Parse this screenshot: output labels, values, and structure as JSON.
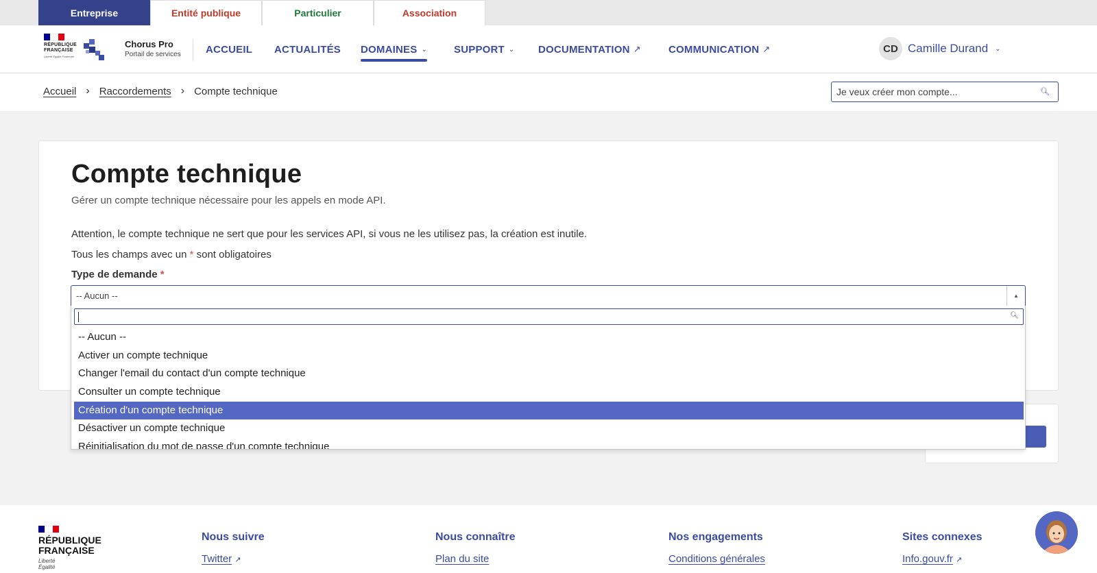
{
  "audience_tabs": [
    {
      "label": "Entreprise",
      "color": "#ffffff"
    },
    {
      "label": "Entité publique",
      "color": "#c0392b"
    },
    {
      "label": "Particulier",
      "color": "#1e7a3a"
    },
    {
      "label": "Association",
      "color": "#c0392b"
    }
  ],
  "brand": {
    "rf_line1": "RÉPUBLIQUE",
    "rf_line2": "FRANÇAISE",
    "motto": "Liberté Égalité Fraternité",
    "name": "Chorus Pro",
    "subtitle": "Portail de services"
  },
  "nav": {
    "items": [
      "ACCUEIL",
      "ACTUALITÉS",
      "DOMAINES",
      "SUPPORT",
      "DOCUMENTATION",
      "COMMUNICATION"
    ],
    "active": "DOMAINES"
  },
  "user": {
    "initials": "CD",
    "name": "Camille Durand"
  },
  "breadcrumb": {
    "items": [
      "Accueil",
      "Raccordements",
      "Compte technique"
    ]
  },
  "search": {
    "placeholder": "Je veux créer mon compte..."
  },
  "page": {
    "title": "Compte technique",
    "subtitle": "Gérer un compte technique nécessaire pour les appels en mode API.",
    "warning": "Attention, le compte technique ne sert que pour les services API, si vous ne les utilisez pas, la création est inutile.",
    "required_note_before": "Tous les champs avec un",
    "required_note_after": "sont obligatoires",
    "required_marker": "*"
  },
  "request_type": {
    "label": "Type de demande",
    "value": "-- Aucun --",
    "search_value": "",
    "options": [
      "-- Aucun --",
      "Activer un compte technique",
      "Changer l'email du contact d'un compte technique",
      "Consulter un compte technique",
      "Création d'un compte technique",
      "Désactiver un compte technique",
      "Réinitialisation du mot de passe d'un compte technique"
    ],
    "highlighted": "Création d'un compte technique"
  },
  "footer": {
    "rf_line1": "RÉPUBLIQUE",
    "rf_line2": "FRANÇAISE",
    "motto_line1": "Liberté",
    "motto_line2": "Égalité",
    "columns": [
      {
        "heading": "Nous suivre",
        "link": "Twitter",
        "external": true
      },
      {
        "heading": "Nous connaître",
        "link": "Plan du site",
        "external": false
      },
      {
        "heading": "Nos engagements",
        "link": "Conditions générales",
        "external": false
      },
      {
        "heading": "Sites connexes",
        "link": "Info.gouv.fr",
        "external": true
      }
    ]
  },
  "colors": {
    "primary": "#3a4ba0",
    "highlight": "#5467c2",
    "required": "#d9534f",
    "flag_blue": "#000091",
    "flag_red": "#e1000f"
  },
  "icons": {
    "search": "search-icon",
    "chevron": "chevron-down-icon",
    "external": "external-link-icon",
    "chatbot": "chatbot-avatar-icon"
  }
}
